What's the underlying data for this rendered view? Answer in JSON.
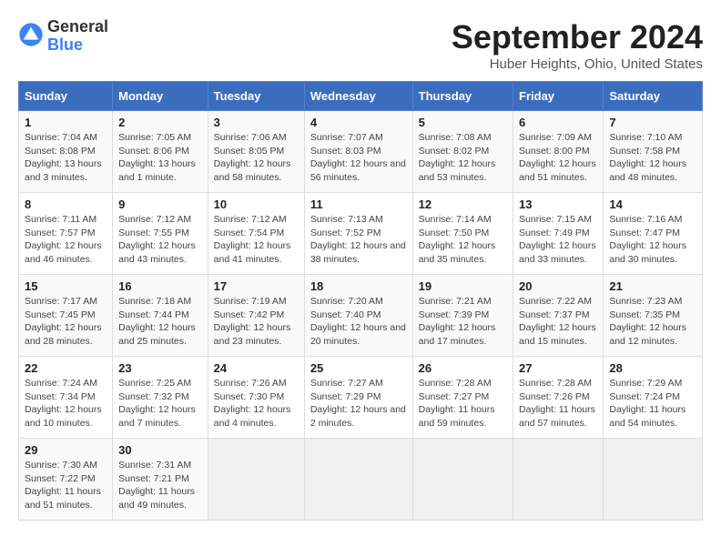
{
  "header": {
    "logo_general": "General",
    "logo_blue": "Blue",
    "title": "September 2024",
    "location": "Huber Heights, Ohio, United States"
  },
  "days_of_week": [
    "Sunday",
    "Monday",
    "Tuesday",
    "Wednesday",
    "Thursday",
    "Friday",
    "Saturday"
  ],
  "weeks": [
    [
      {
        "day": "1",
        "sunrise": "7:04 AM",
        "sunset": "8:08 PM",
        "daylight": "13 hours and 3 minutes."
      },
      {
        "day": "2",
        "sunrise": "7:05 AM",
        "sunset": "8:06 PM",
        "daylight": "13 hours and 1 minute."
      },
      {
        "day": "3",
        "sunrise": "7:06 AM",
        "sunset": "8:05 PM",
        "daylight": "12 hours and 58 minutes."
      },
      {
        "day": "4",
        "sunrise": "7:07 AM",
        "sunset": "8:03 PM",
        "daylight": "12 hours and 56 minutes."
      },
      {
        "day": "5",
        "sunrise": "7:08 AM",
        "sunset": "8:02 PM",
        "daylight": "12 hours and 53 minutes."
      },
      {
        "day": "6",
        "sunrise": "7:09 AM",
        "sunset": "8:00 PM",
        "daylight": "12 hours and 51 minutes."
      },
      {
        "day": "7",
        "sunrise": "7:10 AM",
        "sunset": "7:58 PM",
        "daylight": "12 hours and 48 minutes."
      }
    ],
    [
      {
        "day": "8",
        "sunrise": "7:11 AM",
        "sunset": "7:57 PM",
        "daylight": "12 hours and 46 minutes."
      },
      {
        "day": "9",
        "sunrise": "7:12 AM",
        "sunset": "7:55 PM",
        "daylight": "12 hours and 43 minutes."
      },
      {
        "day": "10",
        "sunrise": "7:12 AM",
        "sunset": "7:54 PM",
        "daylight": "12 hours and 41 minutes."
      },
      {
        "day": "11",
        "sunrise": "7:13 AM",
        "sunset": "7:52 PM",
        "daylight": "12 hours and 38 minutes."
      },
      {
        "day": "12",
        "sunrise": "7:14 AM",
        "sunset": "7:50 PM",
        "daylight": "12 hours and 35 minutes."
      },
      {
        "day": "13",
        "sunrise": "7:15 AM",
        "sunset": "7:49 PM",
        "daylight": "12 hours and 33 minutes."
      },
      {
        "day": "14",
        "sunrise": "7:16 AM",
        "sunset": "7:47 PM",
        "daylight": "12 hours and 30 minutes."
      }
    ],
    [
      {
        "day": "15",
        "sunrise": "7:17 AM",
        "sunset": "7:45 PM",
        "daylight": "12 hours and 28 minutes."
      },
      {
        "day": "16",
        "sunrise": "7:18 AM",
        "sunset": "7:44 PM",
        "daylight": "12 hours and 25 minutes."
      },
      {
        "day": "17",
        "sunrise": "7:19 AM",
        "sunset": "7:42 PM",
        "daylight": "12 hours and 23 minutes."
      },
      {
        "day": "18",
        "sunrise": "7:20 AM",
        "sunset": "7:40 PM",
        "daylight": "12 hours and 20 minutes."
      },
      {
        "day": "19",
        "sunrise": "7:21 AM",
        "sunset": "7:39 PM",
        "daylight": "12 hours and 17 minutes."
      },
      {
        "day": "20",
        "sunrise": "7:22 AM",
        "sunset": "7:37 PM",
        "daylight": "12 hours and 15 minutes."
      },
      {
        "day": "21",
        "sunrise": "7:23 AM",
        "sunset": "7:35 PM",
        "daylight": "12 hours and 12 minutes."
      }
    ],
    [
      {
        "day": "22",
        "sunrise": "7:24 AM",
        "sunset": "7:34 PM",
        "daylight": "12 hours and 10 minutes."
      },
      {
        "day": "23",
        "sunrise": "7:25 AM",
        "sunset": "7:32 PM",
        "daylight": "12 hours and 7 minutes."
      },
      {
        "day": "24",
        "sunrise": "7:26 AM",
        "sunset": "7:30 PM",
        "daylight": "12 hours and 4 minutes."
      },
      {
        "day": "25",
        "sunrise": "7:27 AM",
        "sunset": "7:29 PM",
        "daylight": "12 hours and 2 minutes."
      },
      {
        "day": "26",
        "sunrise": "7:28 AM",
        "sunset": "7:27 PM",
        "daylight": "11 hours and 59 minutes."
      },
      {
        "day": "27",
        "sunrise": "7:28 AM",
        "sunset": "7:26 PM",
        "daylight": "11 hours and 57 minutes."
      },
      {
        "day": "28",
        "sunrise": "7:29 AM",
        "sunset": "7:24 PM",
        "daylight": "11 hours and 54 minutes."
      }
    ],
    [
      {
        "day": "29",
        "sunrise": "7:30 AM",
        "sunset": "7:22 PM",
        "daylight": "11 hours and 51 minutes."
      },
      {
        "day": "30",
        "sunrise": "7:31 AM",
        "sunset": "7:21 PM",
        "daylight": "11 hours and 49 minutes."
      },
      null,
      null,
      null,
      null,
      null
    ]
  ]
}
